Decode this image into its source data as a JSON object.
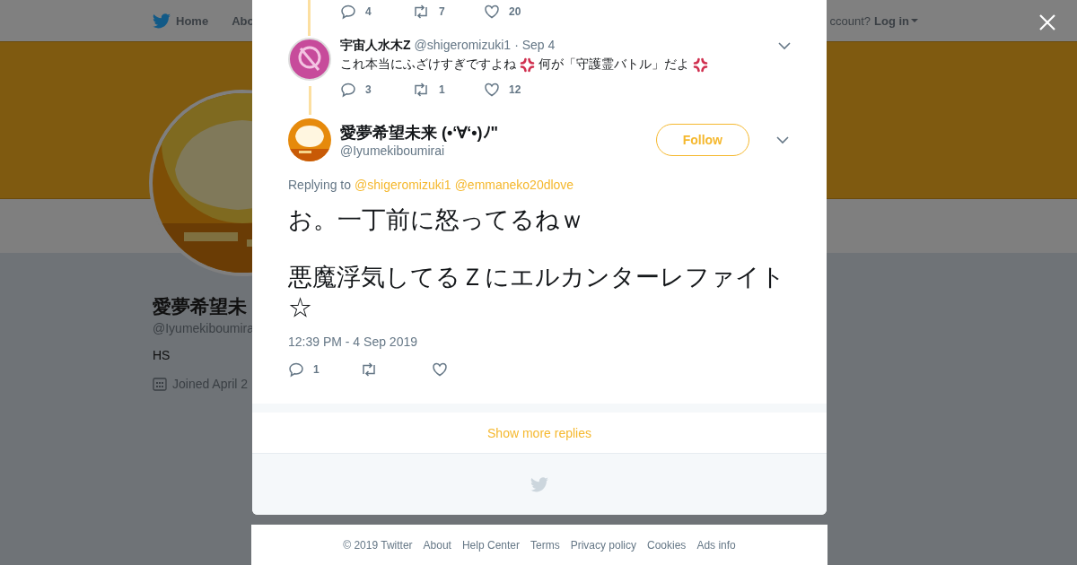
{
  "nav": {
    "items": [
      {
        "label": "Home",
        "kind": "home"
      },
      {
        "label": "Abo",
        "kind": "text"
      }
    ],
    "account_prompt": "ccount?",
    "login": "Log in"
  },
  "profile": {
    "name": "愛夢希望未",
    "handle": "@Iyumekiboumira",
    "bio": "HS",
    "joined": "Joined April 2"
  },
  "thread": {
    "previous_actions": {
      "replies": "4",
      "retweets": "7",
      "likes": "20"
    },
    "reply": {
      "name": "宇宙人水木Z",
      "handle": "@shigeromizuki1",
      "date": "· Sep 4",
      "text": [
        "これ本当にふざけすぎですよね",
        "何が「守護霊バトル」だよ"
      ],
      "actions": {
        "replies": "3",
        "retweets": "1",
        "likes": "12"
      }
    },
    "tweet": {
      "name": "愛夢希望未来 (•‘∀‘•)ﾉ\"",
      "handle": "@Iyumekiboumirai",
      "follow": "Follow",
      "replying_label": "Replying to",
      "mentions": [
        "@shigeromizuki1",
        "@emmaneko20dlove"
      ],
      "paragraphs": [
        "お。一丁前に怒ってるねｗ",
        "悪魔浮気してるＺにエルカンターレファイト☆"
      ],
      "timestamp": "12:39 PM - 4 Sep 2019",
      "actions": {
        "replies": "1"
      }
    }
  },
  "show_more": "Show more replies",
  "footer": [
    "© 2019 Twitter",
    "About",
    "Help Center",
    "Terms",
    "Privacy policy",
    "Cookies",
    "Ads info"
  ]
}
